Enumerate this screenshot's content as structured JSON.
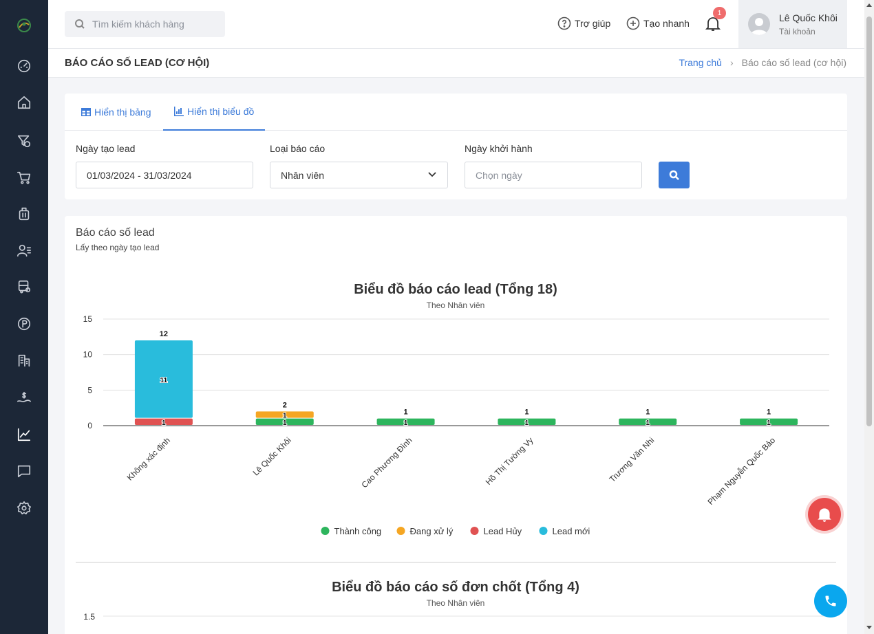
{
  "sidebar": {
    "items": [
      {
        "icon": "dashboard-icon"
      },
      {
        "icon": "home-icon"
      },
      {
        "icon": "funnel-dollar-icon"
      },
      {
        "icon": "cart-icon"
      },
      {
        "icon": "luggage-icon"
      },
      {
        "icon": "user-list-icon"
      },
      {
        "icon": "bus-icon"
      },
      {
        "icon": "parking-icon"
      },
      {
        "icon": "building-icon"
      },
      {
        "icon": "money-hand-icon"
      },
      {
        "icon": "chart-line-icon",
        "active": true
      },
      {
        "icon": "chat-icon"
      },
      {
        "icon": "settings-icon"
      }
    ]
  },
  "topbar": {
    "search_placeholder": "Tìm kiếm khách hàng",
    "help_label": "Trợ giúp",
    "quick_create_label": "Tạo nhanh",
    "notification_count": "1",
    "account_name": "Lê Quốc Khôi",
    "account_sub": "Tài khoản"
  },
  "page": {
    "title": "BÁO CÁO SỐ LEAD (CƠ HỘI)",
    "breadcrumb_home": "Trang chủ",
    "breadcrumb_current": "Báo cáo số lead (cơ hội)"
  },
  "filters": {
    "tab_table": "Hiển thị bảng",
    "tab_chart": "Hiển thị biểu đồ",
    "created_date_label": "Ngày tạo lead",
    "created_date_value": "01/03/2024 - 31/03/2024",
    "report_type_label": "Loại báo cáo",
    "report_type_value": "Nhân viên",
    "departure_label": "Ngày khởi hành",
    "departure_placeholder": "Chọn ngày"
  },
  "report": {
    "title": "Báo cáo số lead",
    "subtitle": "Lấy theo ngày tạo lead",
    "chart2_title": "Biểu đồ báo cáo số đơn chốt (Tổng 4)",
    "chart2_subtitle": "Theo Nhân viên",
    "chart2_first_tick": "1.5"
  },
  "chart_data": {
    "type": "bar",
    "stacked": true,
    "title": "Biểu đồ báo cáo lead (Tổng 18)",
    "subtitle": "Theo Nhân viên",
    "categories": [
      "Không xác định",
      "Lê Quốc Khôi",
      "Cao Phương Đình",
      "Hồ Thị Tường Vy",
      "Trương Văn Nhi",
      "Phạm Nguyễn Quốc Bảo"
    ],
    "series": [
      {
        "name": "Thành công",
        "color": "#2db55d",
        "values": [
          0,
          1,
          1,
          1,
          1,
          1
        ]
      },
      {
        "name": "Đang xử lý",
        "color": "#f5a623",
        "values": [
          0,
          1,
          0,
          0,
          0,
          0
        ]
      },
      {
        "name": "Lead Hủy",
        "color": "#e05252",
        "values": [
          1,
          0,
          0,
          0,
          0,
          0
        ]
      },
      {
        "name": "Lead mới",
        "color": "#29bcdc",
        "values": [
          11,
          0,
          0,
          0,
          0,
          0
        ]
      }
    ],
    "totals": [
      12,
      2,
      1,
      1,
      1,
      1
    ],
    "ylim": [
      0,
      15
    ],
    "yticks": [
      0,
      5,
      10,
      15
    ],
    "grid": true,
    "legend": "bottom"
  }
}
